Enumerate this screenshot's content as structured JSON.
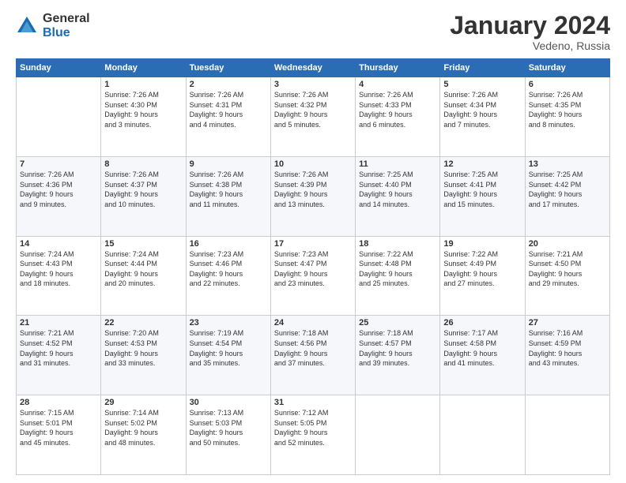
{
  "logo": {
    "general": "General",
    "blue": "Blue"
  },
  "header": {
    "month_year": "January 2024",
    "location": "Vedeno, Russia"
  },
  "weekdays": [
    "Sunday",
    "Monday",
    "Tuesday",
    "Wednesday",
    "Thursday",
    "Friday",
    "Saturday"
  ],
  "weeks": [
    [
      {
        "day": "",
        "info": ""
      },
      {
        "day": "1",
        "info": "Sunrise: 7:26 AM\nSunset: 4:30 PM\nDaylight: 9 hours\nand 3 minutes."
      },
      {
        "day": "2",
        "info": "Sunrise: 7:26 AM\nSunset: 4:31 PM\nDaylight: 9 hours\nand 4 minutes."
      },
      {
        "day": "3",
        "info": "Sunrise: 7:26 AM\nSunset: 4:32 PM\nDaylight: 9 hours\nand 5 minutes."
      },
      {
        "day": "4",
        "info": "Sunrise: 7:26 AM\nSunset: 4:33 PM\nDaylight: 9 hours\nand 6 minutes."
      },
      {
        "day": "5",
        "info": "Sunrise: 7:26 AM\nSunset: 4:34 PM\nDaylight: 9 hours\nand 7 minutes."
      },
      {
        "day": "6",
        "info": "Sunrise: 7:26 AM\nSunset: 4:35 PM\nDaylight: 9 hours\nand 8 minutes."
      }
    ],
    [
      {
        "day": "7",
        "info": "Sunrise: 7:26 AM\nSunset: 4:36 PM\nDaylight: 9 hours\nand 9 minutes."
      },
      {
        "day": "8",
        "info": "Sunrise: 7:26 AM\nSunset: 4:37 PM\nDaylight: 9 hours\nand 10 minutes."
      },
      {
        "day": "9",
        "info": "Sunrise: 7:26 AM\nSunset: 4:38 PM\nDaylight: 9 hours\nand 11 minutes."
      },
      {
        "day": "10",
        "info": "Sunrise: 7:26 AM\nSunset: 4:39 PM\nDaylight: 9 hours\nand 13 minutes."
      },
      {
        "day": "11",
        "info": "Sunrise: 7:25 AM\nSunset: 4:40 PM\nDaylight: 9 hours\nand 14 minutes."
      },
      {
        "day": "12",
        "info": "Sunrise: 7:25 AM\nSunset: 4:41 PM\nDaylight: 9 hours\nand 15 minutes."
      },
      {
        "day": "13",
        "info": "Sunrise: 7:25 AM\nSunset: 4:42 PM\nDaylight: 9 hours\nand 17 minutes."
      }
    ],
    [
      {
        "day": "14",
        "info": "Sunrise: 7:24 AM\nSunset: 4:43 PM\nDaylight: 9 hours\nand 18 minutes."
      },
      {
        "day": "15",
        "info": "Sunrise: 7:24 AM\nSunset: 4:44 PM\nDaylight: 9 hours\nand 20 minutes."
      },
      {
        "day": "16",
        "info": "Sunrise: 7:23 AM\nSunset: 4:46 PM\nDaylight: 9 hours\nand 22 minutes."
      },
      {
        "day": "17",
        "info": "Sunrise: 7:23 AM\nSunset: 4:47 PM\nDaylight: 9 hours\nand 23 minutes."
      },
      {
        "day": "18",
        "info": "Sunrise: 7:22 AM\nSunset: 4:48 PM\nDaylight: 9 hours\nand 25 minutes."
      },
      {
        "day": "19",
        "info": "Sunrise: 7:22 AM\nSunset: 4:49 PM\nDaylight: 9 hours\nand 27 minutes."
      },
      {
        "day": "20",
        "info": "Sunrise: 7:21 AM\nSunset: 4:50 PM\nDaylight: 9 hours\nand 29 minutes."
      }
    ],
    [
      {
        "day": "21",
        "info": "Sunrise: 7:21 AM\nSunset: 4:52 PM\nDaylight: 9 hours\nand 31 minutes."
      },
      {
        "day": "22",
        "info": "Sunrise: 7:20 AM\nSunset: 4:53 PM\nDaylight: 9 hours\nand 33 minutes."
      },
      {
        "day": "23",
        "info": "Sunrise: 7:19 AM\nSunset: 4:54 PM\nDaylight: 9 hours\nand 35 minutes."
      },
      {
        "day": "24",
        "info": "Sunrise: 7:18 AM\nSunset: 4:56 PM\nDaylight: 9 hours\nand 37 minutes."
      },
      {
        "day": "25",
        "info": "Sunrise: 7:18 AM\nSunset: 4:57 PM\nDaylight: 9 hours\nand 39 minutes."
      },
      {
        "day": "26",
        "info": "Sunrise: 7:17 AM\nSunset: 4:58 PM\nDaylight: 9 hours\nand 41 minutes."
      },
      {
        "day": "27",
        "info": "Sunrise: 7:16 AM\nSunset: 4:59 PM\nDaylight: 9 hours\nand 43 minutes."
      }
    ],
    [
      {
        "day": "28",
        "info": "Sunrise: 7:15 AM\nSunset: 5:01 PM\nDaylight: 9 hours\nand 45 minutes."
      },
      {
        "day": "29",
        "info": "Sunrise: 7:14 AM\nSunset: 5:02 PM\nDaylight: 9 hours\nand 48 minutes."
      },
      {
        "day": "30",
        "info": "Sunrise: 7:13 AM\nSunset: 5:03 PM\nDaylight: 9 hours\nand 50 minutes."
      },
      {
        "day": "31",
        "info": "Sunrise: 7:12 AM\nSunset: 5:05 PM\nDaylight: 9 hours\nand 52 minutes."
      },
      {
        "day": "",
        "info": ""
      },
      {
        "day": "",
        "info": ""
      },
      {
        "day": "",
        "info": ""
      }
    ]
  ]
}
